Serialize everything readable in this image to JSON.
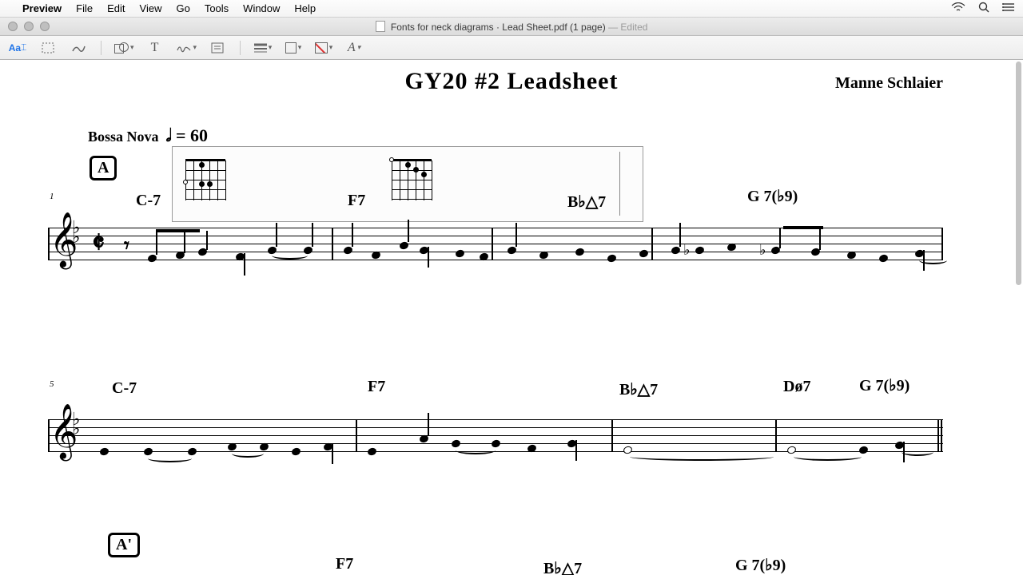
{
  "menubar": {
    "app": "Preview",
    "items": [
      "File",
      "Edit",
      "View",
      "Go",
      "Tools",
      "Window",
      "Help"
    ]
  },
  "window": {
    "doc_title": "Fonts for neck diagrams · Lead Sheet.pdf (1 page)",
    "edited_suffix": " — Edited"
  },
  "toolbar": {
    "text_btn": "Aa",
    "letter_T": "T",
    "letter_A": "A"
  },
  "sheet": {
    "title": "GY20 #2 Leadsheet",
    "composer": "Manne Schlaier",
    "style": "Bossa Nova",
    "tempo_marking": "𝅗𝅥 = 60",
    "rehearsal_A": "A",
    "rehearsal_A2": "A'",
    "meas1": "1",
    "meas5": "5",
    "chords_line1": {
      "c1": "C-7",
      "c2": "F7",
      "c3": "B♭△7",
      "c4": "G 7(♭9)"
    },
    "chords_line2": {
      "c1": "C-7",
      "c2": "F7",
      "c3": "B♭△7",
      "c4a": "Dø7",
      "c4b": "G 7(♭9)"
    },
    "chords_line3": {
      "c2": "F7",
      "c3": "B♭△7",
      "c4": "G 7(♭9)"
    }
  }
}
